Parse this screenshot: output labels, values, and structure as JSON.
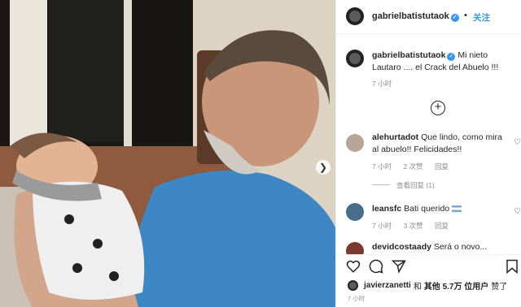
{
  "post": {
    "username": "gabrielbatistutaok",
    "verified_mark": "✓",
    "separator": "•",
    "follow_label": "关注"
  },
  "caption": {
    "username": "gabrielbatistutaok",
    "text": "Mi nieto Lautaro .... el Crack del Abuelo !!!",
    "time": "7 小时"
  },
  "load_more_icon": "plus-circle-icon",
  "comments": [
    {
      "username": "alehurtadot",
      "text": "Que lindo, como mira al abuelo!! Felicidades!!",
      "time": "7 小时",
      "likes": "2 次赞",
      "reply": "回复",
      "view_replies": "查看回复 (1)"
    },
    {
      "username": "leansfc",
      "text": "Bati querido",
      "time": "7 小时",
      "likes": "3 次赞",
      "reply": "回复"
    },
    {
      "username": "devidcostaady",
      "text": "Será o novo..."
    }
  ],
  "actions": {
    "icons": [
      "heart-icon",
      "comment-icon",
      "share-icon",
      "bookmark-icon"
    ]
  },
  "likes": {
    "user": "javierzanetti",
    "and": "和",
    "others": "其他 5.7万 位用户",
    "suffix": "赞了"
  },
  "footer_time": "7 小时",
  "colors": {
    "link": "#3897f0",
    "muted": "#8e8e8e",
    "text": "#262626"
  }
}
